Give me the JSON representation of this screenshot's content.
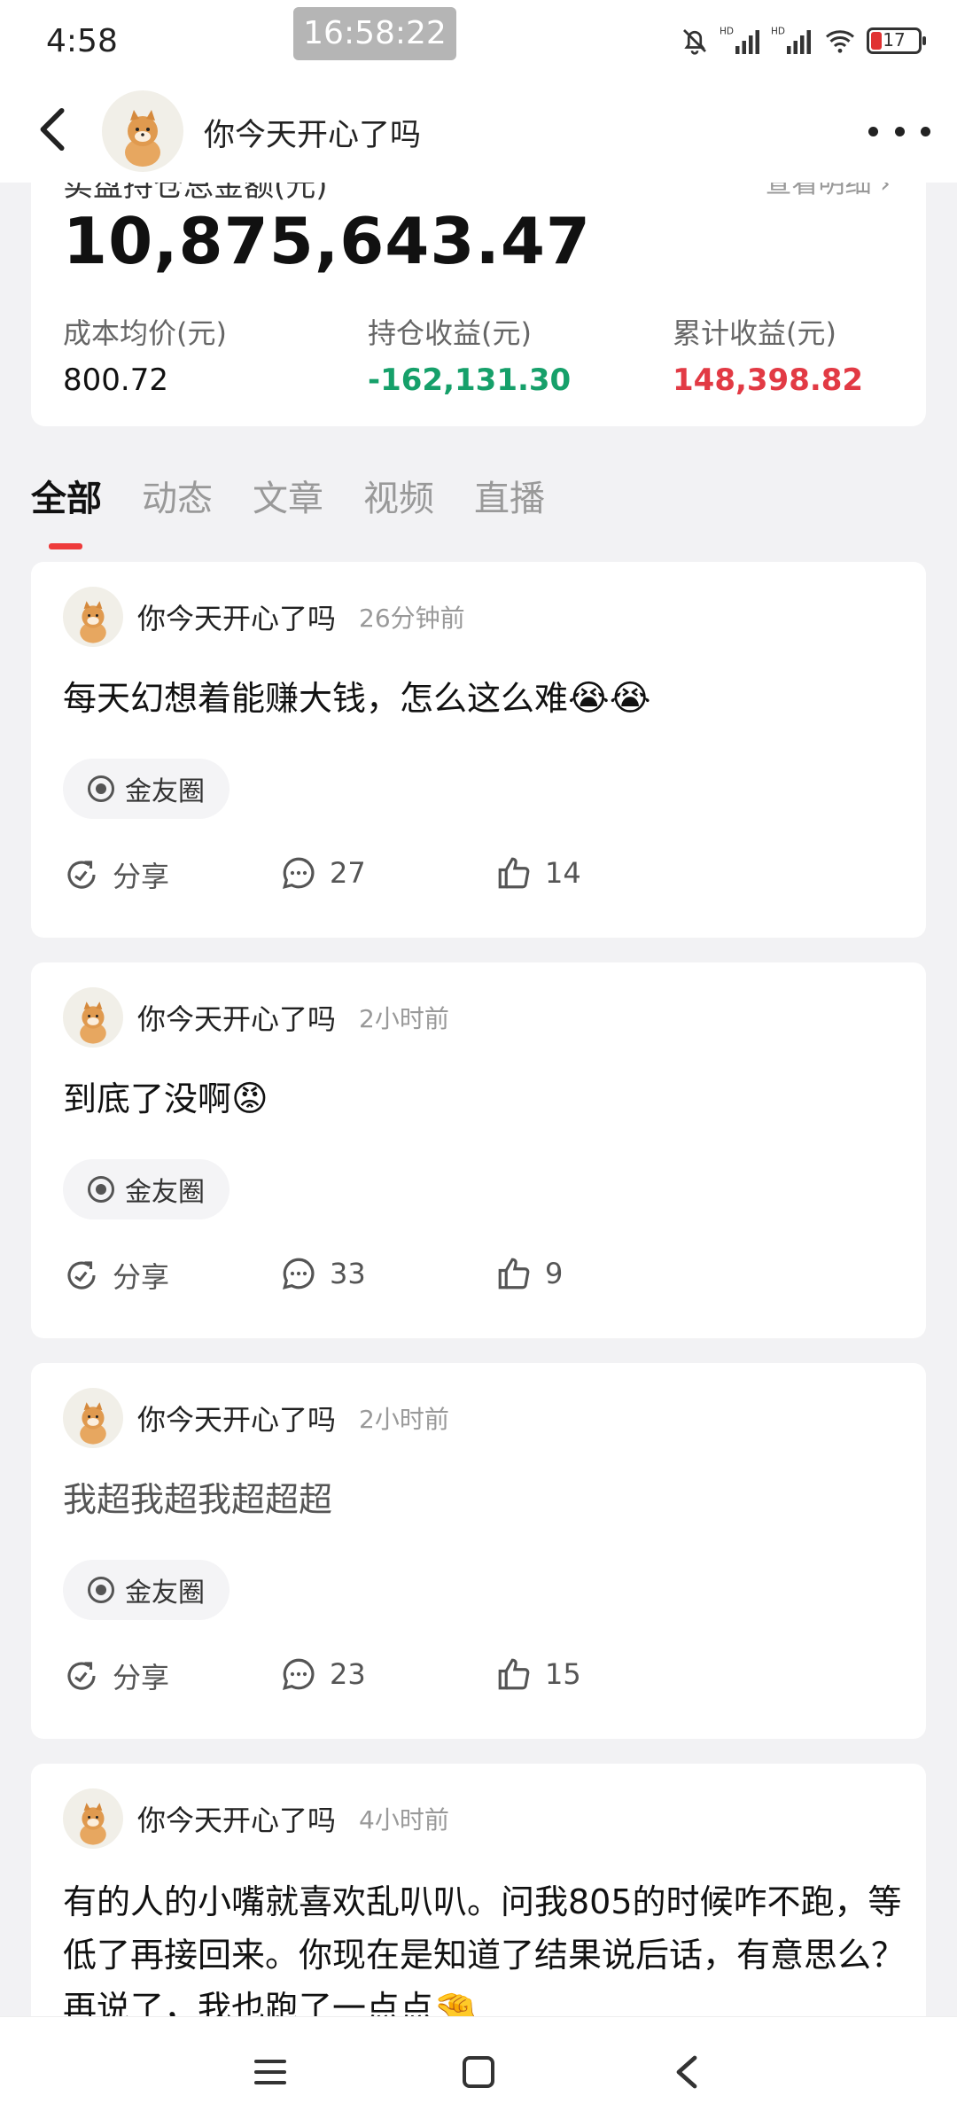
{
  "status_bar": {
    "time": "4:58",
    "overlay_time": "16:58:22",
    "battery": "17",
    "signal_label": "HD"
  },
  "header": {
    "title": "你今天开心了吗",
    "avatar": "shiba-dog-avatar"
  },
  "holdings": {
    "cut_label": "实盘持仓总金额(元)",
    "cut_link": "查看明细 ›",
    "total": "10,875,643.47",
    "stats": [
      {
        "label": "成本均价(元)",
        "value": "800.72"
      },
      {
        "label": "持仓收益(元)",
        "value": "-162,131.30"
      },
      {
        "label": "累计收益(元)",
        "value": "148,398.82"
      }
    ]
  },
  "tabs": [
    "全部",
    "动态",
    "文章",
    "视频",
    "直播"
  ],
  "posts": [
    {
      "author": "你今天开心了吗",
      "time": "26分钟前",
      "text": "每天幻想着能赚大钱，怎么这么难",
      "emoji": "😭😭",
      "topic": "金友圈",
      "share": "分享",
      "comments": "27",
      "likes": "14"
    },
    {
      "author": "你今天开心了吗",
      "time": "2小时前",
      "text": "到底了没啊",
      "emoji": "😡",
      "topic": "金友圈",
      "share": "分享",
      "comments": "33",
      "likes": "9"
    },
    {
      "author": "你今天开心了吗",
      "time": "2小时前",
      "text": "我超我超我超超超",
      "emoji": "",
      "topic": "金友圈",
      "share": "分享",
      "comments": "23",
      "likes": "15"
    },
    {
      "author": "你今天开心了吗",
      "time": "4小时前",
      "text": "有的人的小嘴就喜欢乱叭叭。问我805的时候咋不跑，等低了再接回来。你现在是知道了结果说后话，有意思么？再说了，我也跑了一点点",
      "emoji": "🤏"
    }
  ],
  "colors": {
    "gain_negative": "#16a06a",
    "gain_positive": "#e23a44",
    "tab_indicator": "#ee3b3b"
  }
}
